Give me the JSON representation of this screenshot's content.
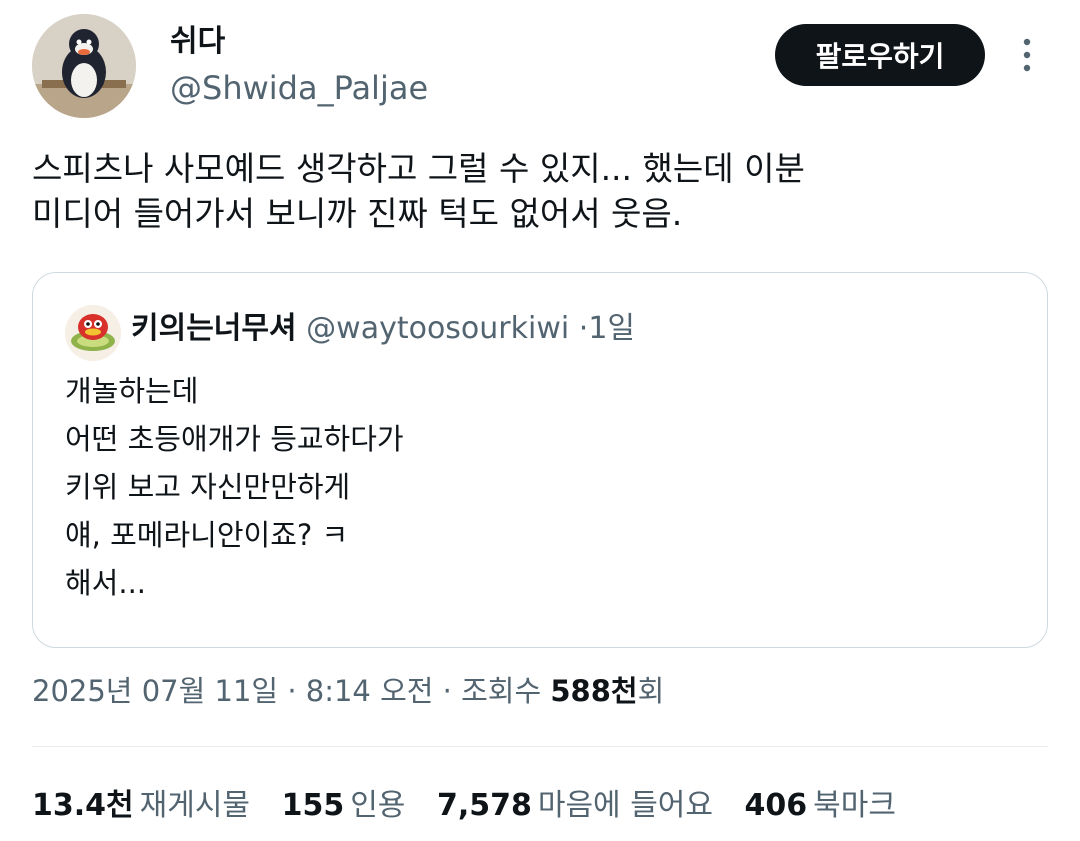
{
  "author": {
    "display_name": "쉬다",
    "handle": "@Shwida_Paljae",
    "avatar_icon": "penguin-avatar-icon"
  },
  "follow_button": {
    "label": "팔로우하기"
  },
  "more_icon": "more-vertical-icon",
  "tweet": {
    "text": "스피츠나 사모예드 생각하고 그럴 수 있지... 했는데 이분\n미디어 들어가서 보니까 진짜 턱도 없어서 웃음."
  },
  "quote": {
    "avatar_icon": "kiwi-avatar-icon",
    "display_name": "키의는너무셔",
    "handle": "@waytoosourkiwi",
    "separator": "·",
    "time": "1일",
    "text": "개놀하는데\n어떤 초등애개가 등교하다가\n키위 보고 자신만만하게\n얘, 포메라니안이죠? ㅋ\n해서..."
  },
  "meta": {
    "date": "2025년 07월 11일",
    "sep1": "·",
    "time": "8:14 오전",
    "sep2": "·",
    "views_label": "조회수",
    "views_num": "588천",
    "views_suffix": "회"
  },
  "stats": {
    "reposts": {
      "num": "13.4천",
      "label": "재게시물"
    },
    "quotes": {
      "num": "155",
      "label": "인용"
    },
    "likes": {
      "num": "7,578",
      "label": "마음에 들어요"
    },
    "bookmarks": {
      "num": "406",
      "label": "북마크"
    }
  },
  "colors": {
    "text_primary": "#0f1419",
    "text_secondary": "#536471",
    "border": "#cfd9de",
    "button_bg": "#0f1419"
  }
}
